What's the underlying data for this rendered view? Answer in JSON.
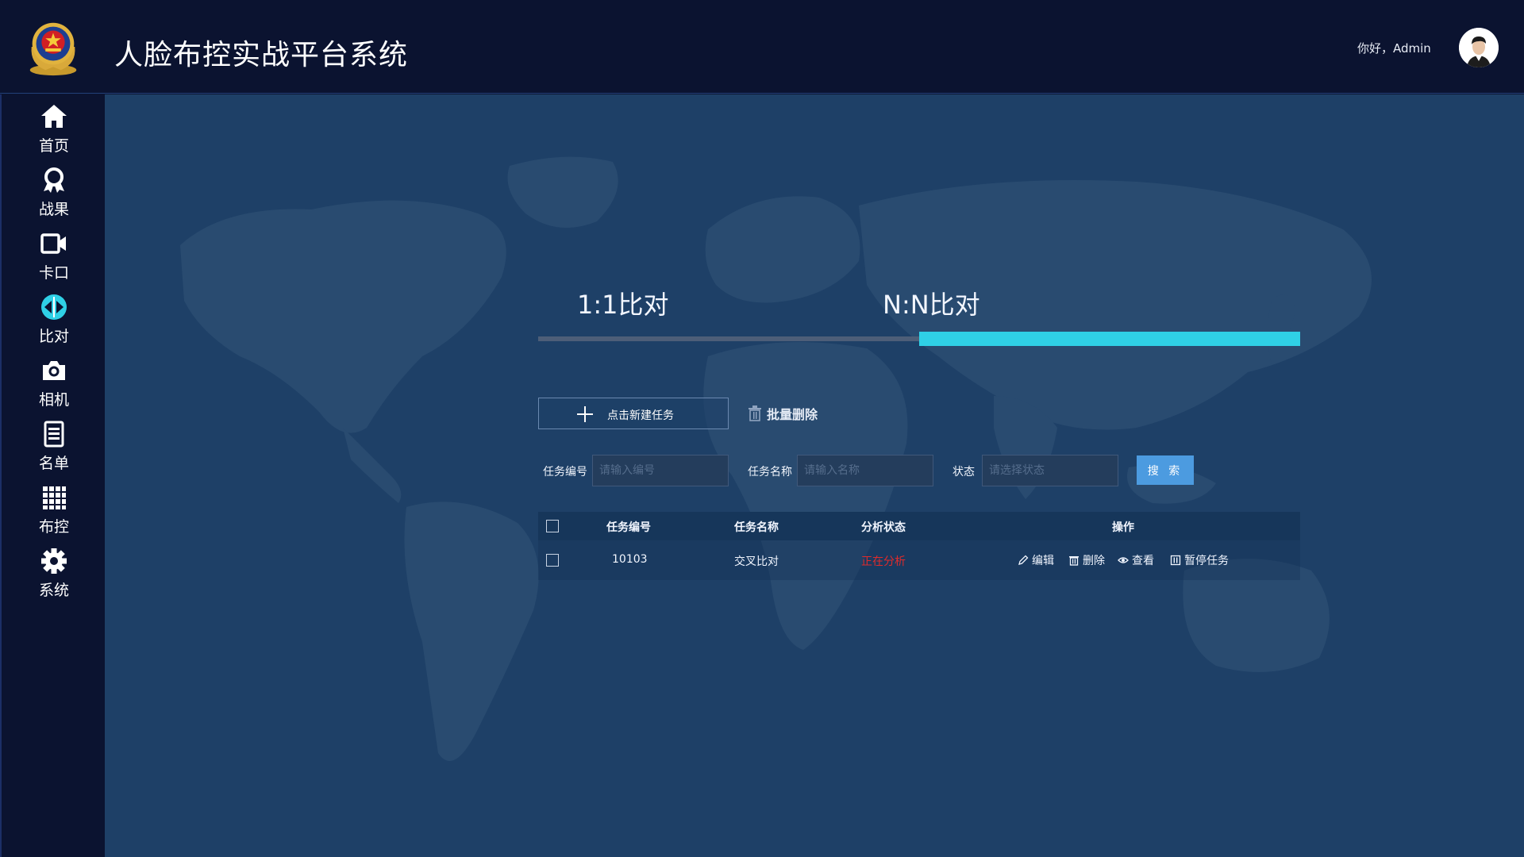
{
  "header": {
    "title": "人脸布控实战平台系统",
    "greeting": "你好，Admin",
    "emblem_icon": "police-emblem-icon",
    "avatar_icon": "user-avatar-icon"
  },
  "sidebar": {
    "items": [
      {
        "label": "首页",
        "icon": "home-icon"
      },
      {
        "label": "战果",
        "icon": "award-icon"
      },
      {
        "label": "卡口",
        "icon": "video-camera-icon"
      },
      {
        "label": "比对",
        "icon": "compare-icon",
        "active": true
      },
      {
        "label": "相机",
        "icon": "camera-icon"
      },
      {
        "label": "名单",
        "icon": "document-list-icon"
      },
      {
        "label": "布控",
        "icon": "grid-icon"
      },
      {
        "label": "系统",
        "icon": "gear-icon"
      }
    ]
  },
  "tabs": [
    {
      "label": "1:1比对",
      "active": false
    },
    {
      "label": "N:N比对",
      "active": true
    }
  ],
  "toolbar": {
    "new_task_label": "点击新建任务",
    "batch_delete_label": "批量删除"
  },
  "filters": {
    "task_no_label": "任务编号",
    "task_no_placeholder": "请输入编号",
    "task_name_label": "任务名称",
    "task_name_placeholder": "请输入名称",
    "status_label": "状态",
    "status_placeholder": "请选择状态",
    "search_label": "搜 索"
  },
  "table": {
    "columns": [
      "任务编号",
      "任务名称",
      "分析状态",
      "操作"
    ],
    "rows": [
      {
        "task_no": "10103",
        "task_name": "交叉比对",
        "status": "正在分析",
        "actions": {
          "edit": "编辑",
          "delete": "删除",
          "view": "查看",
          "pause": "暂停任务"
        }
      }
    ]
  },
  "colors": {
    "header_bg": "#0b1330",
    "main_bg": "#1e4067",
    "active_tab": "#2fd0e6",
    "search_button": "#4c9be0",
    "status_running": "#e02b2b"
  }
}
